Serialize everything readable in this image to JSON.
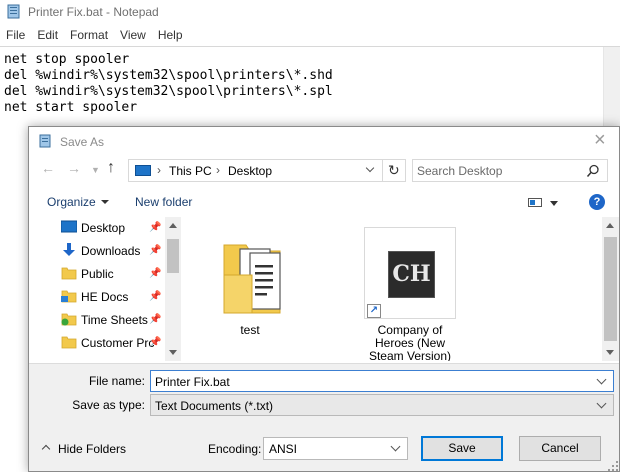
{
  "notepad": {
    "title": "Printer Fix.bat - Notepad",
    "menu": [
      "File",
      "Edit",
      "Format",
      "View",
      "Help"
    ],
    "lines": [
      "net stop spooler",
      "del %windir%\\system32\\spool\\printers\\*.shd",
      "del %windir%\\system32\\spool\\printers\\*.spl",
      "net start spooler"
    ]
  },
  "dialog": {
    "title": "Save As",
    "breadcrumb": [
      "This PC",
      "Desktop"
    ],
    "search_placeholder": "Search Desktop",
    "toolbar": {
      "organize": "Organize",
      "new_folder": "New folder"
    },
    "nav_items": [
      {
        "label": "Desktop",
        "icon": "desktop-icon",
        "pinned": true
      },
      {
        "label": "Downloads",
        "icon": "download-arrow-icon",
        "pinned": true
      },
      {
        "label": "Public",
        "icon": "folder-icon",
        "pinned": true
      },
      {
        "label": "HE Docs",
        "icon": "network-folder-icon",
        "pinned": true
      },
      {
        "label": "Time Sheets",
        "icon": "synced-folder-icon",
        "pinned": true
      },
      {
        "label": "Customer Prc",
        "icon": "folder-icon",
        "pinned": true
      }
    ],
    "files": [
      {
        "name": "test",
        "icon": "documents-folder-icon"
      },
      {
        "name_lines": [
          "Company of",
          "Heroes (New",
          "Steam Version)"
        ],
        "icon": "game-shortcut-icon",
        "logo_text": "CH"
      }
    ],
    "form": {
      "file_name_label": "File name:",
      "file_name_value": "Printer Fix.bat",
      "save_as_type_label": "Save as type:",
      "save_as_type_value": "Text Documents (*.txt)",
      "hide_folders": "Hide Folders",
      "encoding_label": "Encoding:",
      "encoding_value": "ANSI",
      "save": "Save",
      "cancel": "Cancel"
    }
  },
  "colors": {
    "accent_blue": "#0078d7",
    "folder_yellow": "#f2c94c",
    "help_blue": "#1e66c8"
  }
}
